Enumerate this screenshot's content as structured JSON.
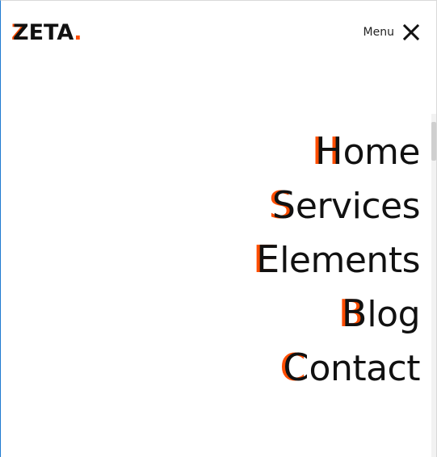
{
  "brand": {
    "logo_first": "Z",
    "logo_rest": "ETA",
    "logo_dot": ".",
    "accent_color": "#ff4d00",
    "text_color": "#111111"
  },
  "header": {
    "menu_label": "Menu",
    "close_icon": "close-icon"
  },
  "nav": {
    "items": [
      {
        "first": "H",
        "rest": "ome"
      },
      {
        "first": "S",
        "rest": "ervices"
      },
      {
        "first": "E",
        "rest": "lements"
      },
      {
        "first": "B",
        "rest": "log"
      },
      {
        "first": "C",
        "rest": "ontact"
      }
    ]
  }
}
